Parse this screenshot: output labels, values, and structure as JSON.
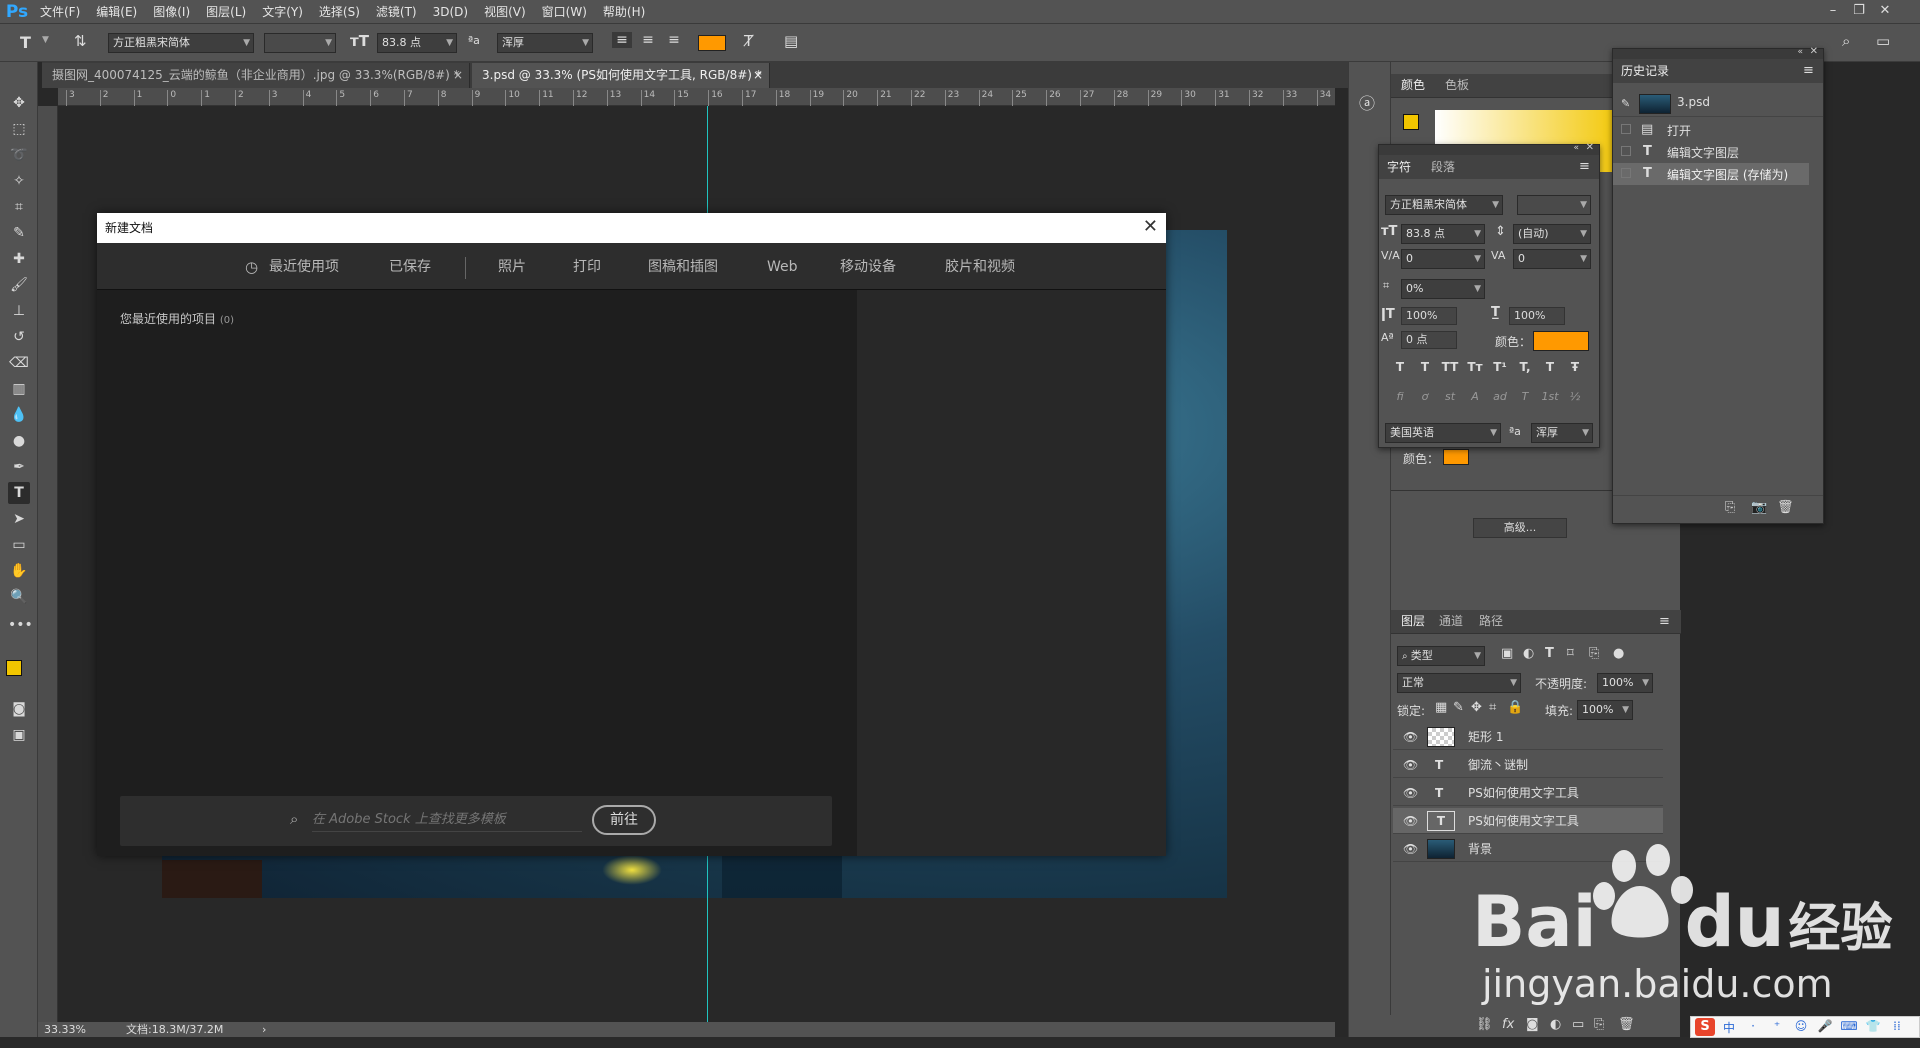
{
  "app": {
    "logo": "Ps"
  },
  "menu": [
    "文件(F)",
    "编辑(E)",
    "图像(I)",
    "图层(L)",
    "文字(Y)",
    "选择(S)",
    "滤镜(T)",
    "3D(D)",
    "视图(V)",
    "窗口(W)",
    "帮助(H)"
  ],
  "options": {
    "font_family": "方正粗黑宋简体",
    "font_size": "83.8 点",
    "aa_label": "ªa",
    "antialias": "浑厚",
    "text_color": "#ff9900"
  },
  "tabs": [
    {
      "label": "摄图网_400074125_云端的鲸鱼（非企业商用）.jpg @ 33.3%(RGB/8#) *",
      "close": "×"
    },
    {
      "label": "3.psd @ 33.3% (PS如何使用文字工具, RGB/8#) *",
      "close": "×"
    }
  ],
  "ruler_h": [
    "3",
    "2",
    "1",
    "0",
    "1",
    "2",
    "3",
    "4",
    "5",
    "6",
    "7",
    "8",
    "9",
    "10",
    "11",
    "12",
    "13",
    "14",
    "15",
    "16",
    "17",
    "18",
    "19",
    "20",
    "21",
    "22",
    "23",
    "24",
    "25",
    "26",
    "27",
    "28",
    "29",
    "30",
    "31",
    "32",
    "33",
    "34"
  ],
  "dialog": {
    "title": "新建文档",
    "close": "✕",
    "nav": [
      "最近使用项",
      "已保存",
      "照片",
      "打印",
      "图稿和插图",
      "Web",
      "移动设备",
      "胶片和视频"
    ],
    "recent_label": "您最近使用的项目",
    "recent_count": "(0)",
    "search_placeholder": "在 Adobe Stock 上查找更多模板",
    "goto_button": "前往"
  },
  "status": {
    "zoom": "33.33%",
    "doc": "文档:18.3M/37.2M",
    "arrow": "›"
  },
  "color_panel": {
    "tabs": [
      "颜色",
      "色板"
    ],
    "fg": "#f2c600"
  },
  "character_panel": {
    "tabs": [
      "字符",
      "段落"
    ],
    "font": "方正粗黑宋简体",
    "size": "83.8 点",
    "leading": "(自动)",
    "kerning": "0",
    "tracking": "0",
    "scale_percent": "0%",
    "v_scale": "100%",
    "h_scale": "100%",
    "baseline": "0 点",
    "color_label": "颜色：",
    "color": "#ff9900",
    "style_buttons": [
      "T",
      "T",
      "TT",
      "Tт",
      "T¹",
      "T,",
      "T",
      "Ŧ"
    ],
    "ot_buttons": [
      "fi",
      "ơ",
      "st",
      "A",
      "ad",
      "T",
      "1st",
      "½"
    ],
    "language": "美国英语",
    "aa_label": "ªa",
    "antialias": "浑厚"
  },
  "paragraph_panel": {
    "color_label": "颜色：",
    "color": "#ff9900",
    "advanced": "高级..."
  },
  "history_panel": {
    "title": "历史记录",
    "snapshot": "3.psd",
    "items": [
      "打开",
      "编辑文字图层",
      "编辑文字图层 (存储为)"
    ]
  },
  "layers_panel": {
    "tabs": [
      "图层",
      "通道",
      "路径"
    ],
    "filter": "类型",
    "blend": "正常",
    "opacity_label": "不透明度:",
    "opacity": "100%",
    "lock_label": "锁定:",
    "fill_label": "填充:",
    "fill": "100%",
    "layers": [
      {
        "name": "矩形 1",
        "type": "shape"
      },
      {
        "name": "御流丶谜制",
        "type": "text"
      },
      {
        "name": "PS如何使用文字工具",
        "type": "text"
      },
      {
        "name": "PS如何使用文字工具",
        "type": "text",
        "selected": true
      },
      {
        "name": "背景",
        "type": "image"
      }
    ]
  },
  "watermark": {
    "brand": "Bai",
    "brand2": "du",
    "cn": "经验",
    "url": "jingyan.baidu.com"
  },
  "tray": [
    "中",
    "·",
    "⁺",
    "☺",
    "🎤",
    "⌨",
    "👕",
    "⁞⁞"
  ]
}
